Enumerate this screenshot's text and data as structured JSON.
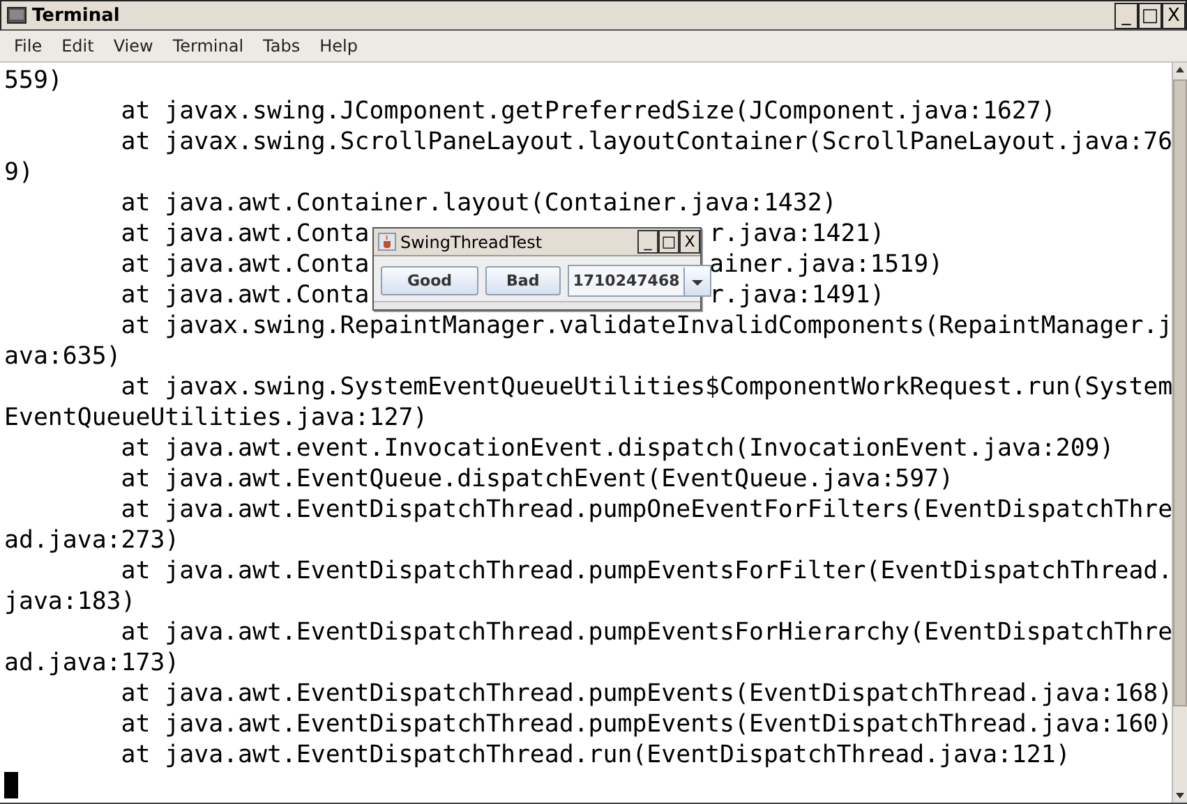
{
  "window": {
    "title": "Terminal",
    "controls": [
      "_",
      "□",
      "X"
    ]
  },
  "menu": [
    {
      "label": "File"
    },
    {
      "label": "Edit"
    },
    {
      "label": "View"
    },
    {
      "label": "Terminal"
    },
    {
      "label": "Tabs"
    },
    {
      "label": "Help"
    }
  ],
  "terminal": {
    "lines": [
      {
        "text": "559)"
      },
      {
        "text": "        at javax.swing.JComponent.getPreferredSize(JComponent.java:1627)"
      },
      {
        "text": "        at javax.swing.ScrollPaneLayout.layoutContainer(ScrollPaneLayout.java:76"
      },
      {
        "text": "9)"
      },
      {
        "text": "        at java.awt.Container.layout(Container.java:1432)"
      },
      {
        "text": "        at java.awt.Conta",
        "right": "r.java:1421)"
      },
      {
        "text": "        at java.awt.Conta",
        "right": "ainer.java:1519)"
      },
      {
        "text": "        at java.awt.Conta",
        "right": "r.java:1491)"
      },
      {
        "text": "        at javax.swing.RepaintManager.validateInvalidComponents(RepaintManager.j"
      },
      {
        "text": "ava:635)"
      },
      {
        "text": "        at javax.swing.SystemEventQueueUtilities$ComponentWorkRequest.run(System"
      },
      {
        "text": "EventQueueUtilities.java:127)"
      },
      {
        "text": "        at java.awt.event.InvocationEvent.dispatch(InvocationEvent.java:209)"
      },
      {
        "text": "        at java.awt.EventQueue.dispatchEvent(EventQueue.java:597)"
      },
      {
        "text": "        at java.awt.EventDispatchThread.pumpOneEventForFilters(EventDispatchThre"
      },
      {
        "text": "ad.java:273)"
      },
      {
        "text": "        at java.awt.EventDispatchThread.pumpEventsForFilter(EventDispatchThread."
      },
      {
        "text": "java:183)"
      },
      {
        "text": "        at java.awt.EventDispatchThread.pumpEventsForHierarchy(EventDispatchThre"
      },
      {
        "text": "ad.java:173)"
      },
      {
        "text": "        at java.awt.EventDispatchThread.pumpEvents(EventDispatchThread.java:168)"
      },
      {
        "text": "        at java.awt.EventDispatchThread.pumpEvents(EventDispatchThread.java:160)"
      },
      {
        "text": "        at java.awt.EventDispatchThread.run(EventDispatchThread.java:121)"
      }
    ]
  },
  "dialog": {
    "title": "SwingThreadTest",
    "controls": [
      "_",
      "□",
      "X"
    ],
    "buttons": [
      "Good",
      "Bad"
    ],
    "combo": {
      "value": "1710247468"
    }
  }
}
